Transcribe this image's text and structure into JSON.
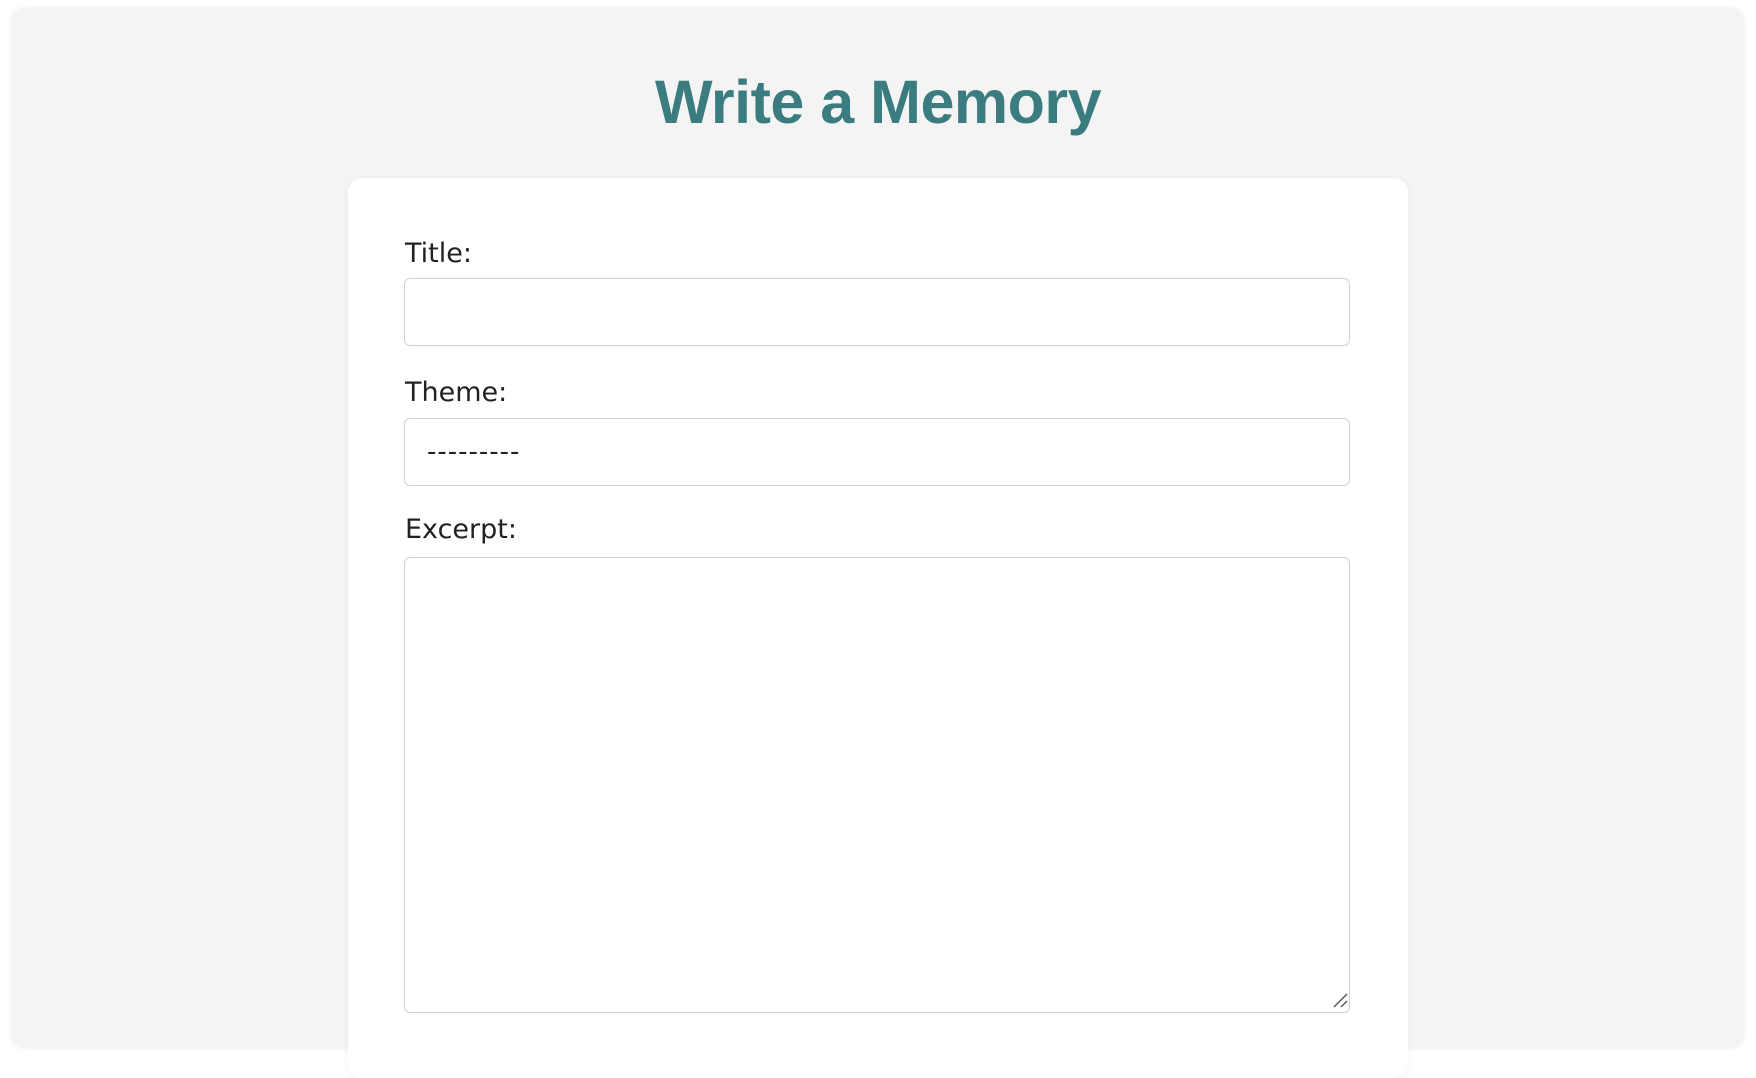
{
  "page": {
    "title": "Write a Memory"
  },
  "form": {
    "title_label": "Title:",
    "title_value": "",
    "theme_label": "Theme:",
    "theme_selected": "---------",
    "excerpt_label": "Excerpt:",
    "excerpt_value": ""
  },
  "colors": {
    "accent": "#3a7c7f",
    "background": "#f4f4f4",
    "card": "#ffffff",
    "border": "#cfcfcf",
    "text": "#222222"
  },
  "icons": {
    "resize_grip": "resize-grip-icon"
  }
}
